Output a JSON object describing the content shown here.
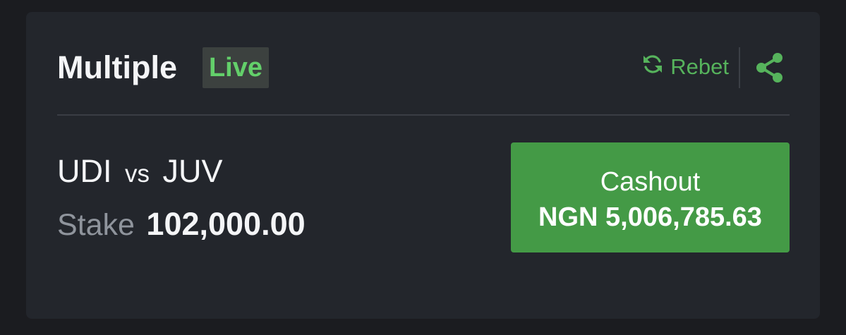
{
  "header": {
    "title": "Multiple",
    "live_badge": "Live",
    "rebet_label": "Rebet"
  },
  "bet": {
    "home_team": "UDI",
    "vs": "vs",
    "away_team": "JUV",
    "stake_label": "Stake",
    "stake_value": "102,000.00"
  },
  "cashout": {
    "label": "Cashout",
    "amount": "NGN 5,006,785.63"
  },
  "icons": {
    "rebet": "refresh-icon",
    "share": "share-icon"
  },
  "colors": {
    "accent_green": "#449a46",
    "live_text": "#63cf6a",
    "card_bg": "#23262c",
    "page_bg": "#1b1c20"
  }
}
